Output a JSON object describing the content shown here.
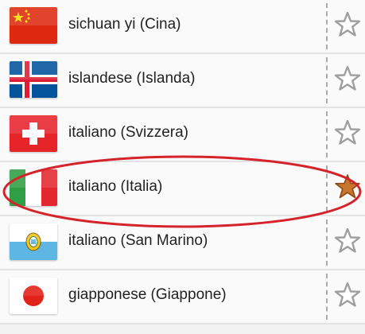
{
  "languages": [
    {
      "label": "sichuan yi (Cina)",
      "flag": "china-flag-icon",
      "favorite": false
    },
    {
      "label": "islandese (Islanda)",
      "flag": "iceland-flag-icon",
      "favorite": false
    },
    {
      "label": "italiano (Svizzera)",
      "flag": "switzerland-flag-icon",
      "favorite": false
    },
    {
      "label": "italiano (Italia)",
      "flag": "italy-flag-icon",
      "favorite": true,
      "highlighted": true
    },
    {
      "label": "italiano (San Marino)",
      "flag": "san-marino-flag-icon",
      "favorite": false
    },
    {
      "label": "giapponese (Giappone)",
      "flag": "japan-flag-icon",
      "favorite": false
    }
  ],
  "colors": {
    "star_off": "#9e9e9e",
    "star_on": "#c8742c",
    "highlight_ring": "#d4232a"
  }
}
